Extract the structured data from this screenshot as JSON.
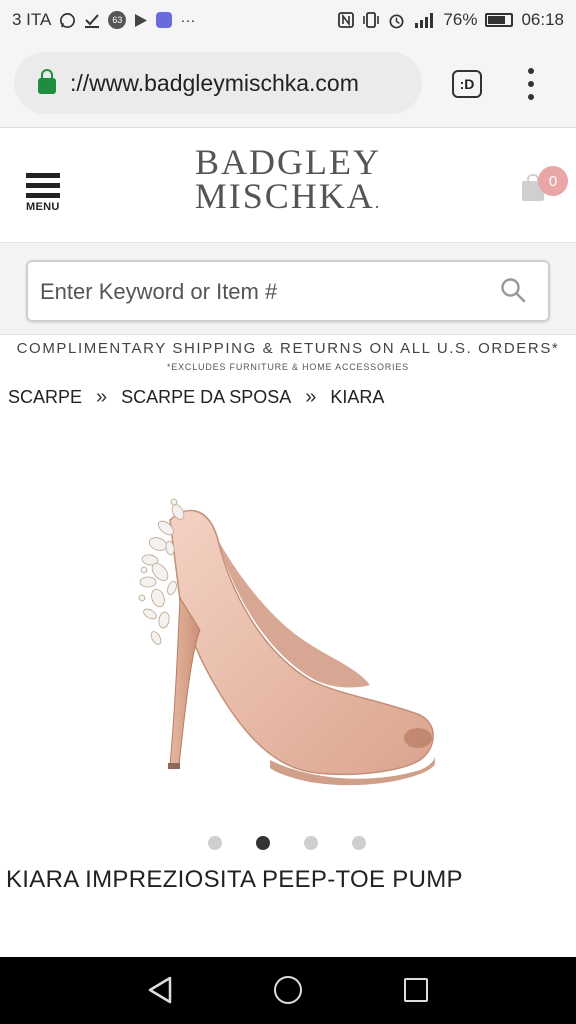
{
  "status_bar": {
    "carrier": "3 ITA",
    "notif_count": "63",
    "battery": "76%",
    "battery_level": 0.76,
    "time": "06:18",
    "icons": [
      "whatsapp-icon",
      "download-done-icon",
      "badge-icon",
      "play-icon",
      "shield-icon",
      "more-icon",
      "nfc-icon",
      "vibrate-icon",
      "alarm-icon",
      "signal-icon",
      "battery-icon"
    ]
  },
  "browser": {
    "url": "://www.badgleymischka.com",
    "tab_switcher_label": ":D",
    "lock_color": "#1e8e3e"
  },
  "site": {
    "menu_label": "MENU",
    "logo_line1": "BADGLEY",
    "logo_line2": "MISCHKA",
    "cart_count": "0",
    "badge_color": "#e8a6a6"
  },
  "search": {
    "placeholder": "Enter Keyword or Item #",
    "value": ""
  },
  "promo": {
    "main": "COMPLIMENTARY SHIPPING & RETURNS ON ALL U.S. ORDERS*",
    "sub": "*EXCLUDES FURNITURE & HOME ACCESSORIES"
  },
  "breadcrumb": {
    "items": [
      "SCARPE",
      "SCARPE DA SPOSA",
      "KIARA"
    ],
    "separator": "»"
  },
  "product": {
    "title": "KIARA IMPREZIOSITA PEEP-TOE PUMP",
    "image_alt": "blush satin peep-toe pump with crystal embellished heel",
    "carousel": {
      "count": 4,
      "active_index": 2
    }
  },
  "nav": {
    "icons": [
      "back-icon",
      "home-icon",
      "recents-icon"
    ]
  }
}
